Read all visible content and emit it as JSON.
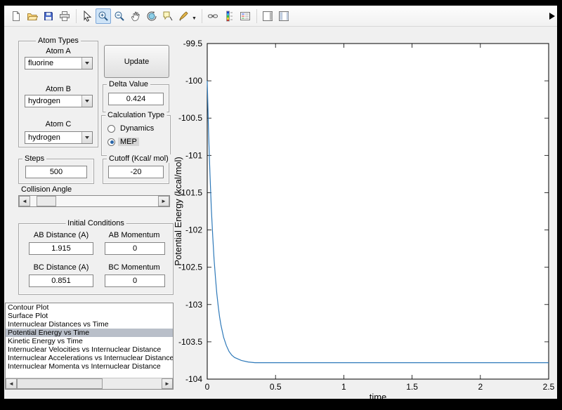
{
  "colors": {
    "figure_bg": "#f0f0f0",
    "toolbar_bg": "#f7f7f7",
    "list_selection": "#b9bfc9",
    "line_blue": "#2e79b9"
  },
  "toolbar": {
    "icons": [
      "new-figure",
      "open-file",
      "save-figure",
      "print-figure",
      "edit-plot",
      "zoom-in",
      "zoom-out",
      "pan",
      "rotate-3d",
      "data-cursor",
      "brush",
      "link-plot",
      "insert-colorbar",
      "insert-legend",
      "hide-plot-tools",
      "show-plot-tools"
    ],
    "active_icon": "zoom-in"
  },
  "controls": {
    "atom_types": {
      "title": "Atom Types",
      "fields": [
        {
          "label": "Atom A",
          "value": "fluorine"
        },
        {
          "label": "Atom B",
          "value": "hydrogen"
        },
        {
          "label": "Atom C",
          "value": "hydrogen"
        }
      ]
    },
    "update_button_label": "Update",
    "delta_value": {
      "title": "Delta Value",
      "value": "0.424"
    },
    "calculation_type": {
      "title": "Calculation Type",
      "options": [
        {
          "label": "Dynamics",
          "selected": false
        },
        {
          "label": "MEP",
          "selected": true
        }
      ]
    },
    "steps": {
      "title": "Steps",
      "value": "500"
    },
    "cutoff": {
      "title": "Cutoff (Kcal/ mol)",
      "value": "-20"
    },
    "collision_angle": {
      "label": "Collision Angle",
      "thumb_position": 0.05
    },
    "initial_conditions": {
      "title": "Initial Conditions",
      "fields": [
        {
          "label": "AB Distance (A)",
          "value": "1.915"
        },
        {
          "label": "AB Momentum",
          "value": "0"
        },
        {
          "label": "BC Distance (A)",
          "value": "0.851"
        },
        {
          "label": "BC Momentum",
          "value": "0"
        }
      ]
    },
    "plot_list": {
      "items": [
        "Contour Plot",
        "Surface Plot",
        "Internuclear Distances vs Time",
        "Potential Energy vs Time",
        "Kinetic Energy vs Time",
        "Internuclear Velocities vs Internuclear Distance",
        "Internuclear Accelerations vs Internuclear Distance",
        "Internuclear Momenta vs Internuclear Distance"
      ],
      "selected_index": 3
    }
  },
  "chart_data": {
    "type": "line",
    "title": "",
    "xlabel": "time",
    "ylabel": "Potential Energy (kcal/mol)",
    "xlim": [
      0,
      2.5
    ],
    "ylim": [
      -104,
      -99.5
    ],
    "xticks": [
      0,
      0.5,
      1,
      1.5,
      2,
      2.5
    ],
    "xtick_labels": [
      "0",
      "0.5",
      "1",
      "1.5",
      "2",
      "2.5"
    ],
    "yticks": [
      -99.5,
      -100,
      -100.5,
      -101,
      -101.5,
      -102,
      -102.5,
      -103,
      -103.5,
      -104
    ],
    "ytick_labels": [
      "-99.5",
      "-100",
      "-100.5",
      "-101",
      "-101.5",
      "-102",
      "-102.5",
      "-103",
      "-103.5",
      "-104"
    ],
    "grid": false,
    "legend": null,
    "series": [
      {
        "name": "potential-energy-vs-time",
        "color": "#2e79b9",
        "x": [
          0,
          0.005,
          0.01,
          0.015,
          0.02,
          0.025,
          0.03,
          0.04,
          0.05,
          0.06,
          0.07,
          0.08,
          0.09,
          0.1,
          0.12,
          0.14,
          0.16,
          0.18,
          0.2,
          0.25,
          0.3,
          0.35,
          0.4,
          0.5,
          0.6,
          0.8,
          1.0,
          1.25,
          1.5,
          1.75,
          2.0,
          2.25,
          2.5
        ],
        "y": [
          -100.0,
          -100.36,
          -100.69,
          -100.98,
          -101.25,
          -101.49,
          -101.71,
          -102.08,
          -102.39,
          -102.64,
          -102.85,
          -103.02,
          -103.16,
          -103.27,
          -103.44,
          -103.55,
          -103.63,
          -103.68,
          -103.71,
          -103.75,
          -103.77,
          -103.78,
          -103.78,
          -103.78,
          -103.78,
          -103.78,
          -103.78,
          -103.78,
          -103.78,
          -103.78,
          -103.78,
          -103.78,
          -103.78
        ]
      }
    ]
  }
}
